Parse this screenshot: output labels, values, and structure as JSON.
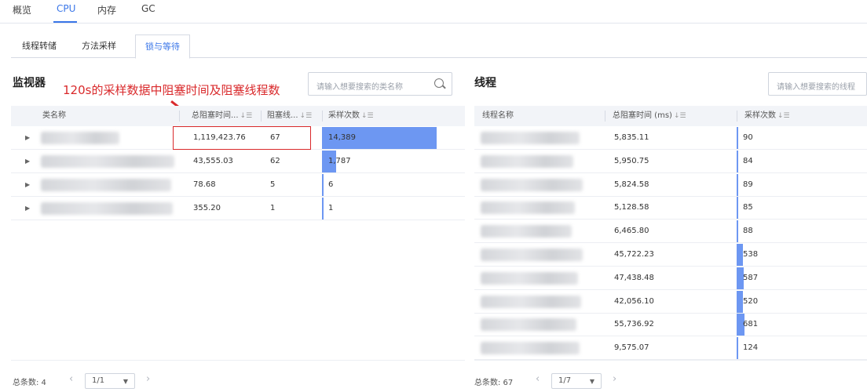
{
  "top_tabs": [
    {
      "label": "概览"
    },
    {
      "label": "CPU"
    },
    {
      "label": "内存"
    },
    {
      "label": "GC"
    }
  ],
  "sub_tabs": [
    {
      "label": "线程转储"
    },
    {
      "label": "方法采样"
    },
    {
      "label": "锁与等待"
    }
  ],
  "monitor": {
    "title": "监视器",
    "search_placeholder": "请输入想要搜索的类名称",
    "columns": {
      "class_name": "类名称",
      "total_block_time": "总阻塞时间...",
      "block_threads": "阻塞线...",
      "samples": "采样次数"
    },
    "rows": [
      {
        "total_block_time": "1,119,423.76",
        "block_threads": "67",
        "samples": "14,389",
        "bar": 1.0
      },
      {
        "total_block_time": "43,555.03",
        "block_threads": "62",
        "samples": "1,787",
        "bar": 0.124
      },
      {
        "total_block_time": "78.68",
        "block_threads": "5",
        "samples": "6",
        "bar": 0.0004
      },
      {
        "total_block_time": "355.20",
        "block_threads": "1",
        "samples": "1",
        "bar": 0.0001
      }
    ],
    "pager": {
      "total": "总条数: 4",
      "page": "1/1"
    }
  },
  "annotation": "120s的采样数据中阻塞时间及阻塞线程数",
  "threads": {
    "title": "线程",
    "search_placeholder": "请输入想要搜索的线程",
    "columns": {
      "thread_name": "线程名称",
      "total_block_time": "总阻塞时间 (ms)",
      "samples": "采样次数"
    },
    "rows": [
      {
        "total_block_time": "5,835.11",
        "samples": "90",
        "bar": 0.132
      },
      {
        "total_block_time": "5,950.75",
        "samples": "84",
        "bar": 0.123
      },
      {
        "total_block_time": "5,824.58",
        "samples": "89",
        "bar": 0.131
      },
      {
        "total_block_time": "5,128.58",
        "samples": "85",
        "bar": 0.125
      },
      {
        "total_block_time": "6,465.80",
        "samples": "88",
        "bar": 0.129
      },
      {
        "total_block_time": "45,722.23",
        "samples": "538",
        "bar": 0.79
      },
      {
        "total_block_time": "47,438.48",
        "samples": "587",
        "bar": 0.862
      },
      {
        "total_block_time": "42,056.10",
        "samples": "520",
        "bar": 0.764
      },
      {
        "total_block_time": "55,736.92",
        "samples": "681",
        "bar": 1.0
      },
      {
        "total_block_time": "9,575.07",
        "samples": "124",
        "bar": 0.182
      }
    ],
    "pager": {
      "total": "总条数: 67",
      "page": "1/7"
    }
  },
  "colors": {
    "accent": "#3a76e8",
    "bar": "#6d97f2",
    "annotation": "#d9292b"
  },
  "icons": {
    "search": "search-icon",
    "sort": "sort-icon",
    "expand": "expand-arrow-icon",
    "prev": "chevron-left-icon",
    "next": "chevron-right-icon",
    "dropdown": "caret-down-icon"
  }
}
